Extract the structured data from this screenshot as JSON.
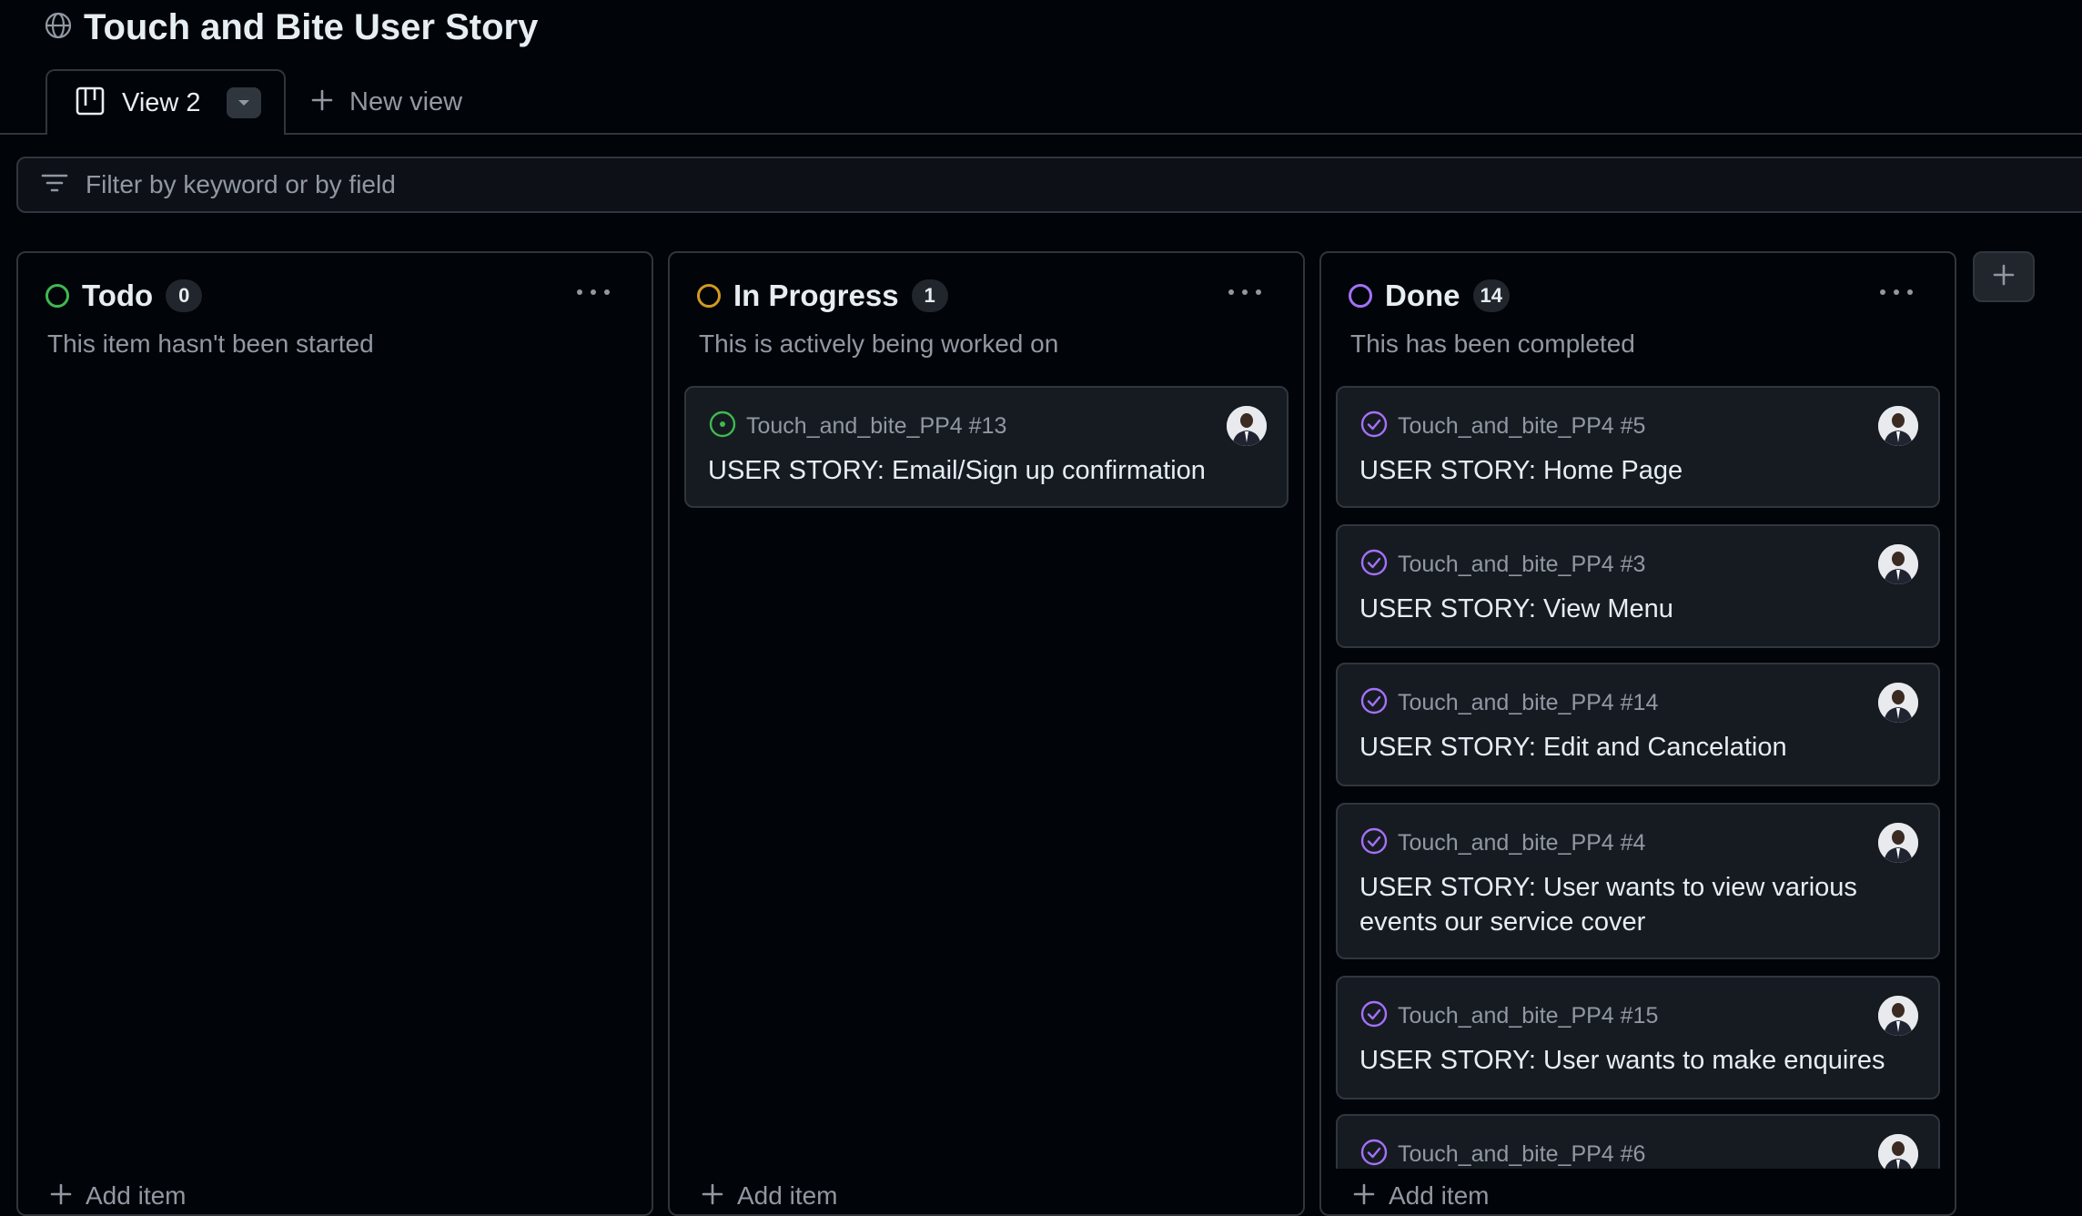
{
  "project": {
    "title": "Touch and Bite User Story",
    "icon": "globe-icon"
  },
  "views": {
    "active_tab_label": "View 2",
    "new_view_label": "New view"
  },
  "filter": {
    "placeholder": "Filter by keyword or by field"
  },
  "colors": {
    "todo": "#3fb950",
    "in_progress": "#d29922",
    "done": "#a371f7",
    "background": "#010409",
    "card": "#161b22",
    "border": "#30363d"
  },
  "columns": [
    {
      "name": "Todo",
      "count": "0",
      "description": "This item hasn't been started",
      "add_item_label": "Add item",
      "cards": []
    },
    {
      "name": "In Progress",
      "count": "1",
      "description": "This is actively being worked on",
      "add_item_label": "Add item",
      "cards": [
        {
          "repo": "Touch_and_bite_PP4 #13",
          "title": "USER STORY: Email/Sign up confirmation",
          "status_icon": "issue-open-icon"
        }
      ]
    },
    {
      "name": "Done",
      "count": "14",
      "description": "This has been completed",
      "add_item_label": "Add item",
      "cards": [
        {
          "repo": "Touch_and_bite_PP4 #5",
          "title": "USER STORY: Home Page",
          "status_icon": "issue-closed-icon"
        },
        {
          "repo": "Touch_and_bite_PP4 #3",
          "title": "USER STORY: View Menu",
          "status_icon": "issue-closed-icon"
        },
        {
          "repo": "Touch_and_bite_PP4 #14",
          "title": "USER STORY: Edit and Cancelation",
          "status_icon": "issue-closed-icon"
        },
        {
          "repo": "Touch_and_bite_PP4 #4",
          "title": "USER STORY: User wants to view various events our service cover",
          "status_icon": "issue-closed-icon"
        },
        {
          "repo": "Touch_and_bite_PP4 #15",
          "title": "USER STORY: User wants to make enquires",
          "status_icon": "issue-closed-icon"
        },
        {
          "repo": "Touch_and_bite_PP4 #6",
          "title": "",
          "status_icon": "issue-closed-icon"
        }
      ]
    }
  ]
}
